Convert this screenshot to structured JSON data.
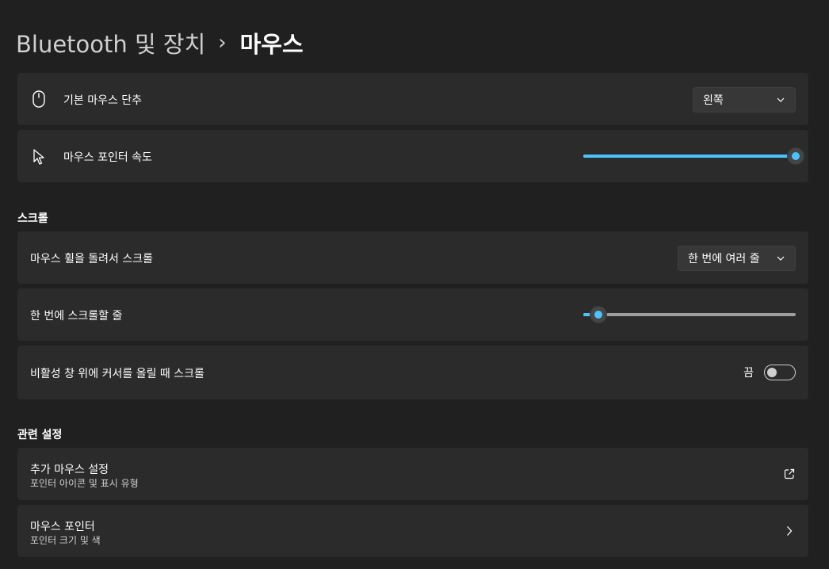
{
  "breadcrumb": {
    "parent": "Bluetooth 및 장치",
    "separator": "›",
    "current": "마우스"
  },
  "primary_button": {
    "icon": "mouse-icon",
    "label": "기본 마우스 단추",
    "value": "왼쪽"
  },
  "pointer_speed": {
    "icon": "pointer-icon",
    "label": "마우스 포인터 속도",
    "level": 1.0
  },
  "scroll": {
    "title": "스크롤",
    "wheel": {
      "label": "마우스 휠을 돌려서 스크롤",
      "value": "한 번에 여러 줄"
    },
    "lines": {
      "label": "한 번에 스크롤할 줄",
      "level": 0.07
    },
    "inactive": {
      "label": "비활성 창 위에 커서를 올릴 때 스크롤",
      "state": "끔",
      "on": false
    }
  },
  "related": {
    "title": "관련 설정",
    "items": [
      {
        "title": "추가 마우스 설정",
        "subtitle": "포인터 아이콘 및 표시 유형",
        "icon": "open-external-icon"
      },
      {
        "title": "마우스 포인터",
        "subtitle": "포인터 크기 및 색",
        "icon": "chevron-right-icon"
      }
    ]
  },
  "colors": {
    "background": "#202020",
    "card": "#2b2b2b",
    "accent": "#4cc2ff",
    "text": "#ffffff"
  }
}
